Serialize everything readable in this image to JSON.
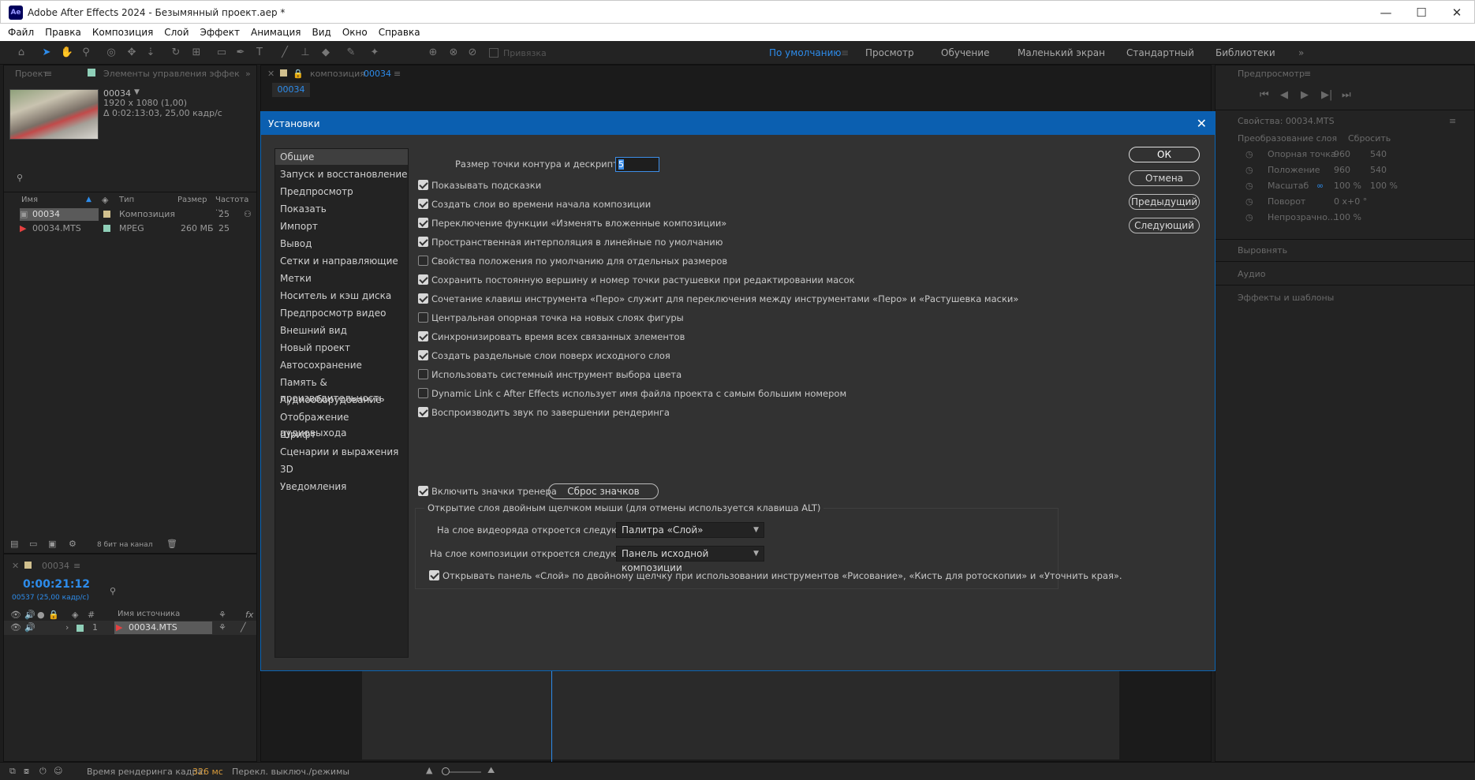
{
  "app": {
    "logo": "Ae",
    "title": "Adobe After Effects 2024 - Безымянный проект.aep *",
    "minimize": "—",
    "maximize": "☐",
    "close": "✕"
  },
  "menu": [
    "Файл",
    "Правка",
    "Композиция",
    "Слой",
    "Эффект",
    "Анимация",
    "Вид",
    "Окно",
    "Справка"
  ],
  "toolbar": {
    "snap_label": "Привязка"
  },
  "workspaces": [
    "По умолчанию",
    "Просмотр",
    "Обучение",
    "Маленький экран",
    "Стандартный",
    "Библиотеки"
  ],
  "project": {
    "tab": "Проект",
    "tab2": "Элементы управления эффек",
    "item_name": "00034",
    "item_res": "1920 x 1080 (1,00)",
    "item_dur": "Δ 0:02:13:03, 25,00 кадр/с",
    "columns": [
      "Имя",
      "Тип",
      "Размер",
      "Частота ..."
    ],
    "rows": [
      {
        "name": "00034",
        "type": "Композиция",
        "size": "",
        "rate": "25"
      },
      {
        "name": "00034.MTS",
        "type": "MPEG",
        "size": "260 МБ",
        "rate": "25"
      }
    ],
    "bitdepth": "8 бит на канал"
  },
  "comp": {
    "tab_prefix": "композиция",
    "tab_name": "00034",
    "sub": "00034"
  },
  "timeline": {
    "tab": "00034",
    "timecode": "0:00:21:12",
    "frames": "00537 (25,00 кадр/с)",
    "col_source": "Имя источника",
    "layer_num": "1",
    "layer_name": "00034.MTS"
  },
  "right": {
    "preview": "Предпросмотр",
    "props": "Свойства: 00034.MTS",
    "transform": "Преобразование слоя",
    "reset": "Сбросить",
    "anchor": "Опорная точка",
    "anchor_x": "960",
    "anchor_y": "540",
    "position": "Положение",
    "pos_x": "960",
    "pos_y": "540",
    "scale": "Масштаб",
    "scale_x": "100 %",
    "scale_y": "100 %",
    "rotation": "Поворот",
    "rot_val": "0 х+0 °",
    "opacity": "Непрозрачно...",
    "op_val": "100 %",
    "align": "Выровнять",
    "audio": "Аудио",
    "effects": "Эффекты и шаблоны"
  },
  "status": {
    "render_label": "Время рендеринга кадра:",
    "render_val": "326 мс",
    "toggle": "Перекл. выключ./режимы"
  },
  "dialog": {
    "title": "Установки",
    "ok": "ОК",
    "cancel": "Отмена",
    "prev": "Предыдущий",
    "next": "Следующий",
    "categories": [
      "Общие",
      "Запуск и восстановление",
      "Предпросмотр",
      "Показать",
      "Импорт",
      "Вывод",
      "Сетки и направляющие",
      "Метки",
      "Носитель и кэш диска",
      "Предпросмотр видео",
      "Внешний вид",
      "Новый проект",
      "Автосохранение",
      "Память & производительность",
      "Аудиооборудование",
      "Отображение аудиовыхода",
      "Шрифт",
      "Сценарии и выражения",
      "3D",
      "Уведомления"
    ],
    "point_size_label": "Размер точки контура и дескриптора:",
    "point_size_val": "5",
    "options": [
      {
        "label": "Показывать подсказки",
        "checked": true
      },
      {
        "label": "Создать слои во времени начала композиции",
        "checked": true
      },
      {
        "label": "Переключение функции «Изменять вложенные композиции»",
        "checked": true
      },
      {
        "label": "Пространственная интерполяция в линейные по умолчанию",
        "checked": true
      },
      {
        "label": "Свойства положения по умолчанию для отдельных размеров",
        "checked": false
      },
      {
        "label": "Сохранить постоянную вершину и номер точки растушевки при редактировании масок",
        "checked": true
      },
      {
        "label": "Сочетание клавиш инструмента «Перо» служит для переключения между инструментами «Перо» и «Растушевка маски»",
        "checked": true
      },
      {
        "label": "Центральная опорная точка на новых слоях фигуры",
        "checked": false
      },
      {
        "label": "Синхронизировать время всех связанных элементов",
        "checked": true
      },
      {
        "label": "Создать раздельные слои поверх исходного слоя",
        "checked": true
      },
      {
        "label": "Использовать системный инструмент выбора цвета",
        "checked": false
      },
      {
        "label": "Dynamic Link с After Effects использует имя файла проекта с самым большим номером",
        "checked": false
      },
      {
        "label": "Воспроизводить звук по завершении рендеринга",
        "checked": true
      }
    ],
    "trainer_label": "Включить значки тренера",
    "trainer_checked": true,
    "trainer_reset": "Сброс значков тренера",
    "group_title": "Открытие слоя двойным щелчком мыши (для отмены используется клавиша ALT)",
    "footage_label": "На слое видеоряда откроется следующее:",
    "footage_val": "Палитра «Слой»",
    "comp_label": "На слое композиции откроется следующее:",
    "comp_val": "Панель исходной композиции",
    "paint_label": "Открывать панель «Слой» по двойному щелчку при использовании инструментов «Рисование», «Кисть для ротоскопии» и «Уточнить края».",
    "paint_checked": true
  }
}
